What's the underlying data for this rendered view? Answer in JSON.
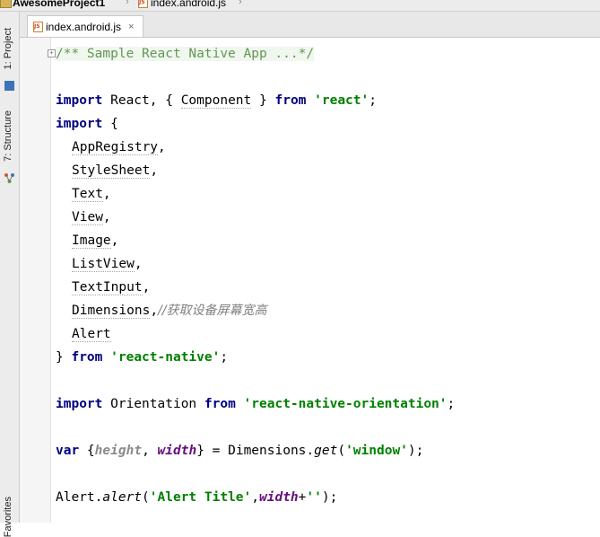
{
  "breadcrumb": {
    "project": "AwesomeProject1",
    "file": "index.android.js",
    "folder_icon": "folder-icon",
    "file_icon": "js-file-icon"
  },
  "sidebar": {
    "project_tab": "1: Project",
    "structure_tab": "7: Structure",
    "favorites_tab": "Favorites"
  },
  "editor": {
    "tab_label": "index.android.js",
    "tab_close": "×",
    "fold_marker": "+"
  },
  "code": {
    "l1": "/** Sample React Native App ...*/",
    "l3_kw": "import",
    "l3_a": " React, { ",
    "l3_b": "Component",
    "l3_c": " } ",
    "l3_kw2": "from",
    "l3_sp": " ",
    "l3_str": "'react'",
    "l3_end": ";",
    "l4_kw": "import",
    "l4_rest": " {",
    "l5": "AppRegistry",
    "l6": "StyleSheet",
    "l7": "Text",
    "l8": "View",
    "l9": "Image",
    "l10": "ListView",
    "l11": "TextInput",
    "l12": "Dimensions",
    "l12_comment": "//获取设备屏幕宽高",
    "l13": "Alert",
    "l14_a": "} ",
    "l14_kw": "from",
    "l14_sp": " ",
    "l14_str": "'react-native'",
    "l14_end": ";",
    "l16_kw": "import",
    "l16_a": " Orientation ",
    "l16_kw2": "from",
    "l16_sp": " ",
    "l16_str": "'react-native-orientation'",
    "l16_end": ";",
    "l18_kw": "var",
    "l18_a": " {",
    "l18_height": "height",
    "l18_b": ", ",
    "l18_width": "width",
    "l18_c": "} = Dimensions.",
    "l18_get": "get",
    "l18_d": "(",
    "l18_str": "'window'",
    "l18_e": ");",
    "l20_a": "Alert.",
    "l20_alert": "alert",
    "l20_b": "(",
    "l20_str": "'Alert Title'",
    "l20_c": ",",
    "l20_width": "width",
    "l20_d": "+",
    "l20_str2": "''",
    "l20_e": ");",
    "comma": ","
  }
}
